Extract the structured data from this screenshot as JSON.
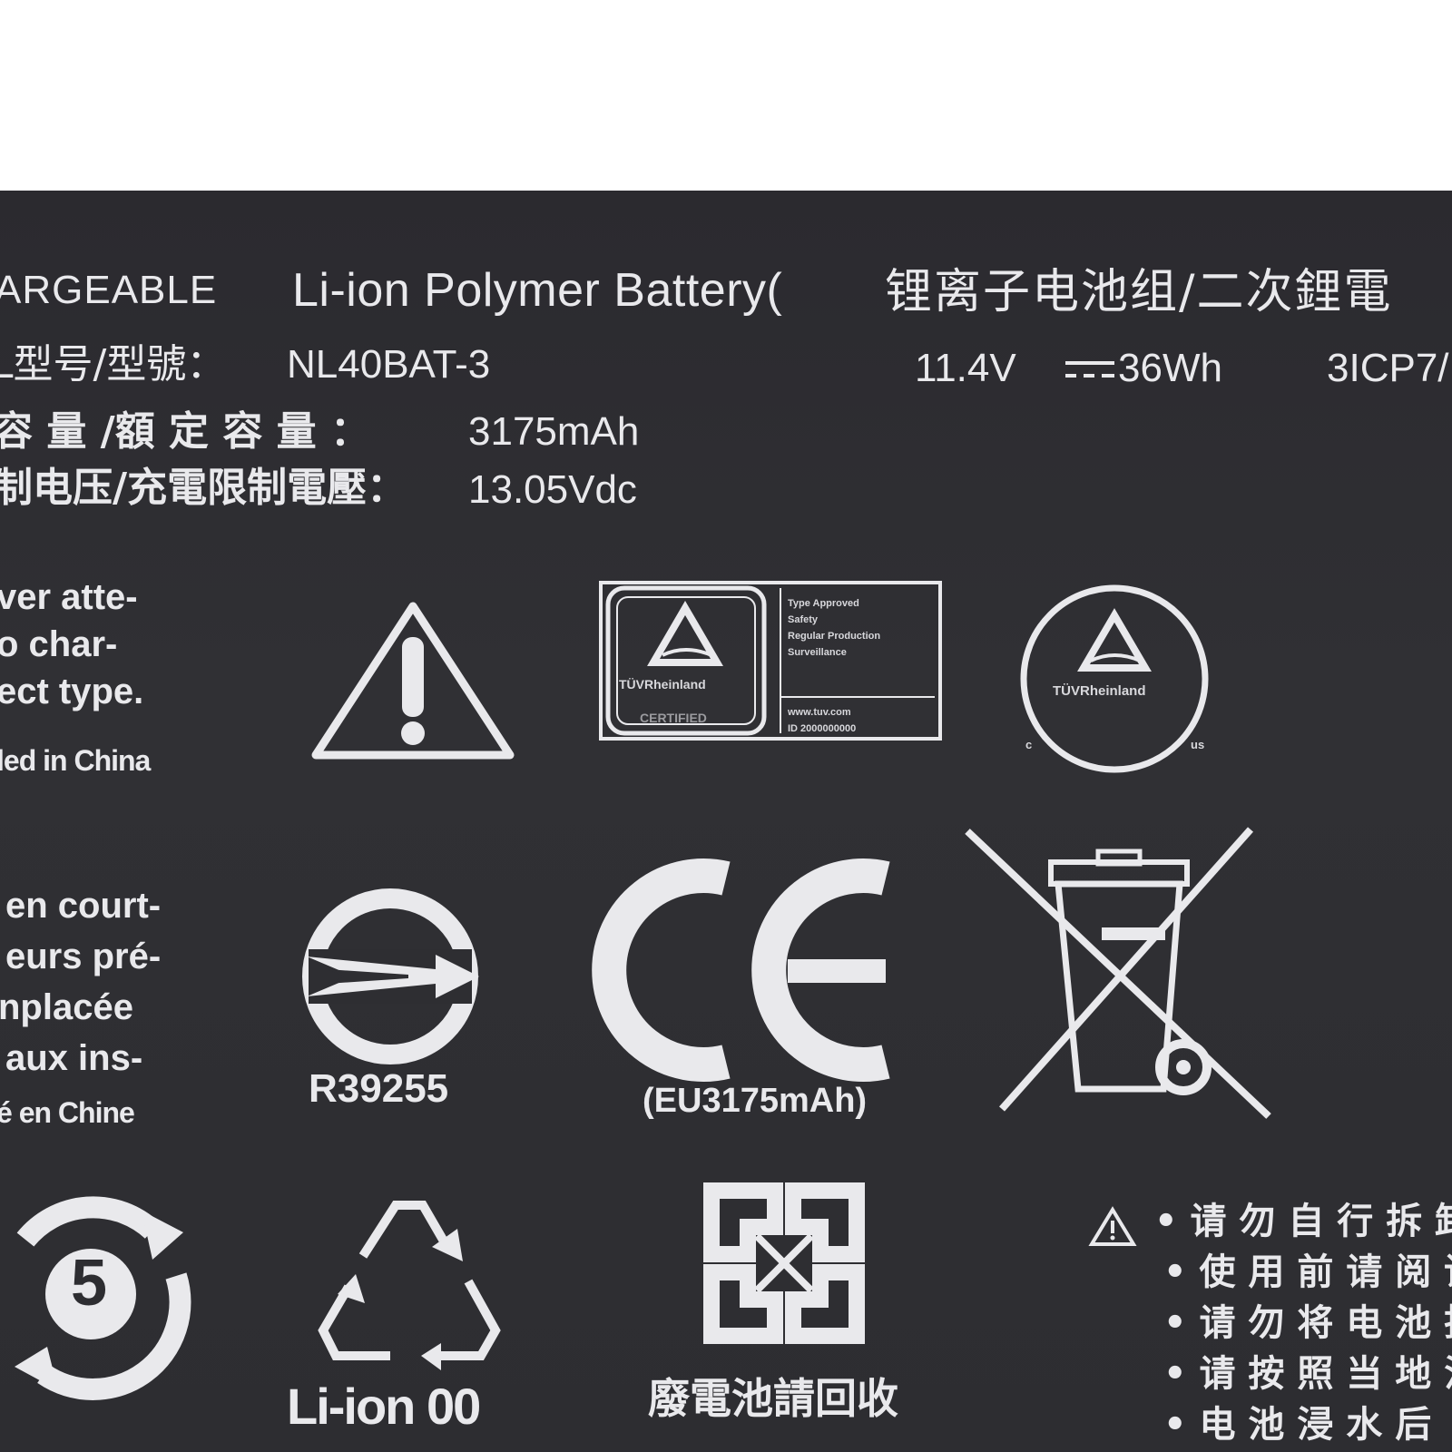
{
  "header": {
    "rechargeable": "ARGEABLE",
    "title_latin": "Li-ion Polymer Battery(",
    "title_cjk": "锂离子电池组/二次鋰電"
  },
  "specs": {
    "model_label": "L型号/型號：",
    "model_value": "NL40BAT-3",
    "voltage": "11.4V",
    "energy": "36Wh",
    "cell": "3ICP7/",
    "capacity_label": "容 量 /額 定 容 量 ：",
    "capacity_value": "3175mAh",
    "charge_label": "制电压/充電限制電壓：",
    "charge_value": "13.05Vdc"
  },
  "warning_en": {
    "lines": [
      "ver atte-",
      "o char-",
      "ect type."
    ],
    "origin": "led in China"
  },
  "warning_fr": {
    "lines": [
      "en court-",
      "eurs pré-",
      "nplacée",
      "aux ins-"
    ],
    "origin": "é en Chine"
  },
  "certs": {
    "tuv_box_lines": [
      "Type Approved",
      "Safety",
      "Regular Production",
      "Surveillance"
    ],
    "tuv_brand": "TÜVRheinland",
    "tuv_certified": "CERTIFIED",
    "tuv_url": "www.tuv.com",
    "tuv_id": "ID 2000000000",
    "tuv_round_brand": "TÜVRheinland",
    "tuv_round_c": "c",
    "tuv_round_us": "us",
    "bsmi_number": "R39255",
    "ce_caption": "(EU3175mAh)"
  },
  "bottom": {
    "epup_years": "5",
    "recycle_caption": "Li-ion 00",
    "taiwan_recycle_caption": "廢電池請回收",
    "notes": [
      "请 勿 自 行 拆 卸",
      "使 用 前 请 阅 读",
      "请 勿 将 电 池 投",
      "请 按 照 当 地 法",
      "电 池 浸 水 后"
    ]
  },
  "colors": {
    "label_bg": "#2d2d31",
    "print": "#e9e9ec",
    "page_bg": "#ffffff"
  }
}
